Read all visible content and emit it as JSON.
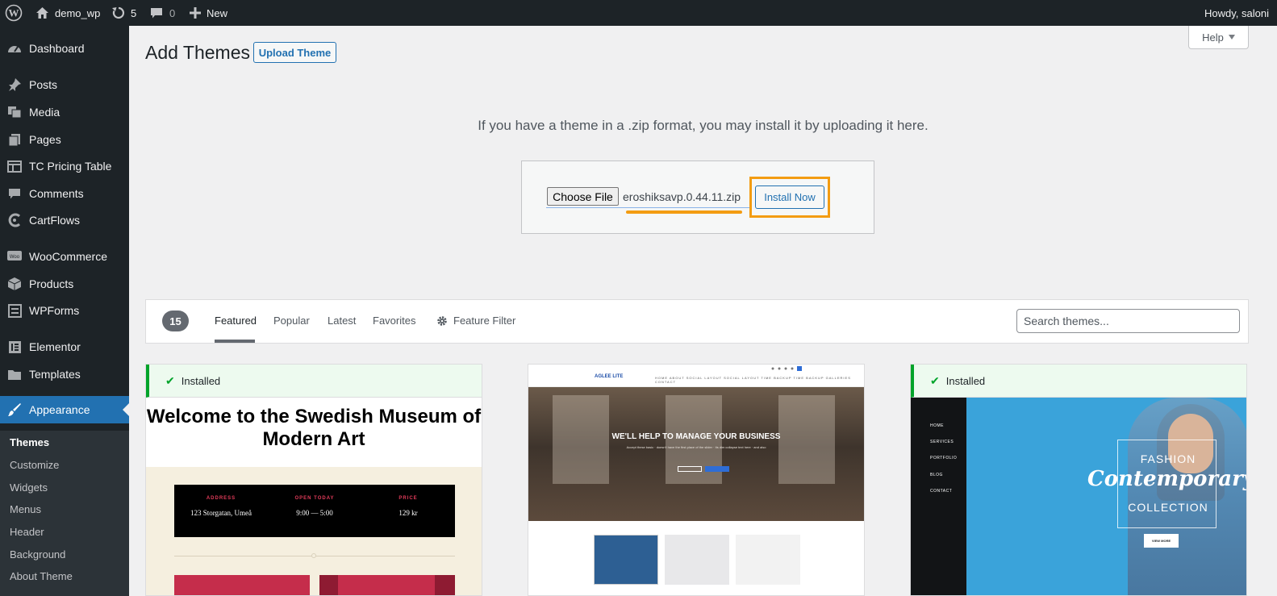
{
  "adminbar": {
    "site_name": "demo_wp",
    "updates_count": "5",
    "comments_count": "0",
    "new_label": "New",
    "howdy": "Howdy, saloni"
  },
  "sidebar": {
    "items": [
      {
        "label": "Dashboard",
        "icon": "dashboard-icon"
      },
      {
        "label": "Posts",
        "icon": "pin-icon"
      },
      {
        "label": "Media",
        "icon": "media-icon"
      },
      {
        "label": "Pages",
        "icon": "pages-icon"
      },
      {
        "label": "TC Pricing Table",
        "icon": "table-icon"
      },
      {
        "label": "Comments",
        "icon": "comment-icon"
      },
      {
        "label": "CartFlows",
        "icon": "cartflows-icon"
      },
      {
        "label": "WooCommerce",
        "icon": "woo-icon"
      },
      {
        "label": "Products",
        "icon": "box-icon"
      },
      {
        "label": "WPForms",
        "icon": "forms-icon"
      },
      {
        "label": "Elementor",
        "icon": "elementor-icon"
      },
      {
        "label": "Templates",
        "icon": "folder-icon"
      },
      {
        "label": "Appearance",
        "icon": "brush-icon"
      }
    ],
    "submenu": [
      "Themes",
      "Customize",
      "Widgets",
      "Menus",
      "Header",
      "Background",
      "About Theme"
    ]
  },
  "page": {
    "title": "Add Themes",
    "upload_button": "Upload Theme",
    "help": "Help"
  },
  "upload": {
    "description": "If you have a theme in a .zip format, you may install it by uploading it here.",
    "choose_file": "Choose File",
    "file_name": "eroshiksavp.0.44.11.zip",
    "install_now": "Install Now"
  },
  "filter": {
    "count": "15",
    "tabs": [
      "Featured",
      "Popular",
      "Latest",
      "Favorites"
    ],
    "feature_filter": "Feature Filter",
    "search_placeholder": "Search themes..."
  },
  "themes": [
    {
      "installed_label": "Installed",
      "preview_title": "Welcome to the Swedish Museum of Modern Art",
      "info": [
        {
          "label": "ADDRESS",
          "value": "123 Storgatan, Umeå"
        },
        {
          "label": "OPEN TODAY",
          "value": "9:00 — 5:00"
        },
        {
          "label": "PRICE",
          "value": "129 kr"
        }
      ]
    },
    {
      "logo": "AGLEE LITE",
      "nav": "HOME   ABOUT   SOCIAL LAYOUT   SOCIAL LAYOUT   TIME BACKUP   TIME BACKUP   GALLERIES   CONTACT",
      "headline": "WE'LL HELP TO MANAGE YOUR BUSINESS",
      "subtext": "Accept these basic · doesn't have the first place of the slider · Its dim collapse text here · and also"
    },
    {
      "installed_label": "Installed",
      "nav": [
        "HOME",
        "SERVICES",
        "PORTFOLIO",
        "BLOG",
        "CONTACT"
      ],
      "line1": "FASHION",
      "line2": "Contemporary",
      "line3": "COLLECTION",
      "button": "VIEW MORE"
    }
  ]
}
